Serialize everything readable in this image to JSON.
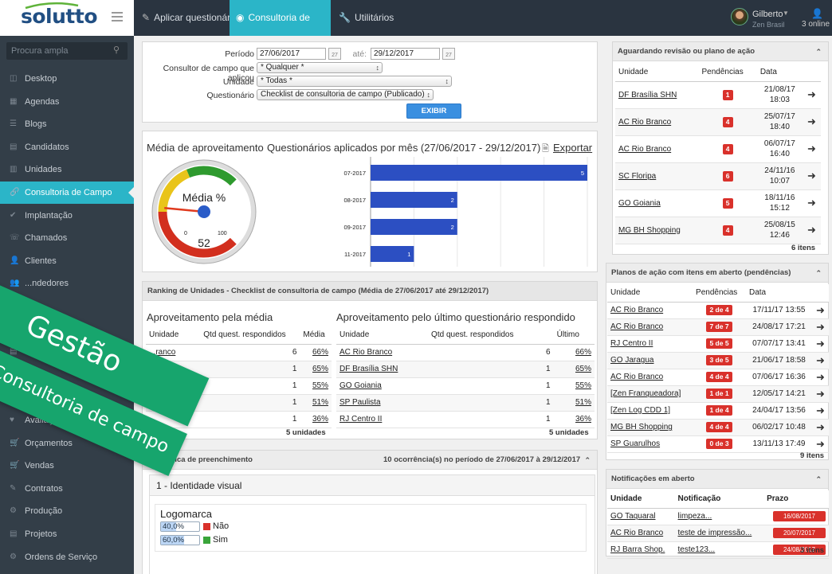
{
  "brand": {
    "name": "solutto"
  },
  "topnav": [
    {
      "icon": "✎",
      "label": "Aplicar questionário"
    },
    {
      "icon": "◉",
      "label": "Consultoria de campo"
    },
    {
      "icon": "🔧",
      "label": "Utilitários"
    }
  ],
  "user": {
    "name": "Gilberto",
    "company": "Zen Brasil",
    "online": "3 online"
  },
  "search": {
    "placeholder": "Procura ampla"
  },
  "sidebar": {
    "items": [
      {
        "label": "Desktop"
      },
      {
        "label": "Agendas"
      },
      {
        "label": "Blogs"
      },
      {
        "label": "Candidatos"
      },
      {
        "label": "Unidades"
      },
      {
        "label": "Consultoria de Campo"
      },
      {
        "label": "Implantação"
      },
      {
        "label": "Chamados"
      },
      {
        "label": "Clientes"
      },
      {
        "label": "...ndedores"
      },
      {
        "label": ""
      },
      {
        "label": ""
      },
      {
        "label": "...tas a Rec..."
      },
      {
        "label": ""
      },
      {
        "label": "Pr..."
      },
      {
        "label": "Avaliações"
      },
      {
        "label": "Orçamentos"
      },
      {
        "label": "Vendas"
      },
      {
        "label": "Contratos"
      },
      {
        "label": "Produção"
      },
      {
        "label": "Projetos"
      },
      {
        "label": "Ordens de Serviço"
      }
    ]
  },
  "filter": {
    "periodo_label": "Período",
    "periodo_from": "27/06/2017",
    "ate_label": "até:",
    "periodo_to": "29/12/2017",
    "cal_day": "27",
    "consultor_label": "Consultor de campo que aplicou",
    "consultor_value": "* Qualquer *",
    "unidade_label": "Unidade",
    "unidade_value": "* Todas *",
    "questionario_label": "Questionário",
    "questionario_value": "Checklist de consultoria de campo (Publicado)",
    "exibir_label": "EXIBIR"
  },
  "gauge": {
    "title": "Média de aproveitamento",
    "label": "Média %",
    "min": "0",
    "max": "100",
    "value": 52
  },
  "chart_data": {
    "type": "bar",
    "title": "Questionários aplicados por mês (27/06/2017 - 29/12/2017)",
    "categories": [
      "07-2017",
      "08-2017",
      "09-2017",
      "11-2017"
    ],
    "values": [
      5,
      2,
      2,
      1
    ],
    "xlim": [
      0,
      5
    ],
    "orientation": "horizontal",
    "grid": true
  },
  "export_label": "Exportar",
  "ranking": {
    "title": "Ranking de Unidades - Checklist de consultoria de campo (Média de 27/06/2017 até 29/12/2017)",
    "left": {
      "title": "Aproveitamento pela média",
      "headers": [
        "Unidade",
        "Qtd quest. respondidos",
        "Média"
      ],
      "rows": [
        {
          "unidade": "...ranco",
          "qtd": "6",
          "val": "66%"
        },
        {
          "unidade": "...ia SHN",
          "qtd": "1",
          "val": "65%"
        },
        {
          "unidade": "GO Goiania",
          "qtd": "1",
          "val": "55%"
        },
        {
          "unidade": "...aulista",
          "qtd": "1",
          "val": "51%"
        },
        {
          "unidade": "",
          "qtd": "1",
          "val": "36%"
        }
      ],
      "footer": "5 unidades"
    },
    "right": {
      "title": "Aproveitamento pelo último questionário respondido",
      "headers": [
        "Unidade",
        "Qtd quest. respondidos",
        "Último"
      ],
      "rows": [
        {
          "unidade": "AC Rio Branco",
          "qtd": "6",
          "val": "66%"
        },
        {
          "unidade": "DF Brasília SHN",
          "qtd": "1",
          "val": "65%"
        },
        {
          "unidade": "GO Goiania",
          "qtd": "1",
          "val": "55%"
        },
        {
          "unidade": "SP Paulista",
          "qtd": "1",
          "val": "51%"
        },
        {
          "unidade": "RJ Centro II",
          "qtd": "1",
          "val": "36%"
        }
      ],
      "footer": "5 unidades"
    }
  },
  "estatistica": {
    "title": "Estatística de preenchimento",
    "summary": "10 ocorrência(s) no período de 27/06/2017 à 29/12/2017",
    "section": "1 - Identidade visual",
    "question": "Logomarca",
    "answers": [
      {
        "pct": "40,0%",
        "fill": 0.4,
        "label": "Não",
        "color": "#d9312b"
      },
      {
        "pct": "60,0%",
        "fill": 0.6,
        "label": "Sim",
        "color": "#3aa53a"
      }
    ]
  },
  "aguardando": {
    "title": "Aguardando revisão ou plano de ação",
    "headers": [
      "Unidade",
      "Pendências",
      "Data"
    ],
    "rows": [
      {
        "unidade": "DF Brasília SHN",
        "pend": "1",
        "date": "21/08/17",
        "time": "18:03"
      },
      {
        "unidade": "AC Rio Branco",
        "pend": "4",
        "date": "25/07/17",
        "time": "18:40"
      },
      {
        "unidade": "AC Rio Branco",
        "pend": "4",
        "date": "06/07/17",
        "time": "16:40"
      },
      {
        "unidade": "SC Floripa",
        "pend": "6",
        "date": "24/11/16",
        "time": "10:07"
      },
      {
        "unidade": "GO Goiania",
        "pend": "5",
        "date": "18/11/16",
        "time": "15:12"
      },
      {
        "unidade": "MG BH Shopping",
        "pend": "4",
        "date": "25/08/15",
        "time": "12:46"
      }
    ],
    "footer": "6 itens"
  },
  "planos": {
    "title": "Planos de ação com itens em aberto (pendências)",
    "headers": [
      "Unidade",
      "Pendências",
      "Data"
    ],
    "rows": [
      {
        "unidade": "AC Rio Branco",
        "pend": "2 de 4",
        "date": "17/11/17 13:55"
      },
      {
        "unidade": "AC Rio Branco",
        "pend": "7 de 7",
        "date": "24/08/17 17:21"
      },
      {
        "unidade": "RJ Centro II",
        "pend": "5 de 5",
        "date": "07/07/17 13:41"
      },
      {
        "unidade": "GO Jaragua",
        "pend": "3 de 5",
        "date": "21/06/17 18:58"
      },
      {
        "unidade": "AC Rio Branco",
        "pend": "4 de 4",
        "date": "07/06/17 16:36"
      },
      {
        "unidade": "[Zen Franqueadora]",
        "pend": "1 de 1",
        "date": "12/05/17 14:21"
      },
      {
        "unidade": "[Zen Log CDD 1]",
        "pend": "1 de 4",
        "date": "24/04/17 13:56"
      },
      {
        "unidade": "MG BH Shopping",
        "pend": "4 de 4",
        "date": "06/02/17 10:48"
      },
      {
        "unidade": "SP Guarulhos",
        "pend": "0 de 3",
        "date": "13/11/13 17:49"
      }
    ],
    "footer": "9 itens"
  },
  "notificacoes": {
    "title": "Notificações em aberto",
    "headers": [
      "Unidade",
      "Notificação",
      "Prazo"
    ],
    "rows": [
      {
        "unidade": "GO Taquaral",
        "notif": "limpeza...",
        "prazo": "16/08/2017"
      },
      {
        "unidade": "AC Rio Branco",
        "notif": "teste de impressão...",
        "prazo": "20/07/2017"
      },
      {
        "unidade": "RJ Barra Shop.",
        "notif": "teste123...",
        "prazo": "24/08/2017"
      }
    ],
    "footer": "3 itens"
  },
  "ribbons": {
    "gestao": "Gestão",
    "consultoria": "Consultoria de campo"
  },
  "colors": {
    "accent": "#2bb5c8",
    "bar": "#2c4fc2",
    "badge": "#d9312b",
    "ribbon": "#17a56d"
  }
}
